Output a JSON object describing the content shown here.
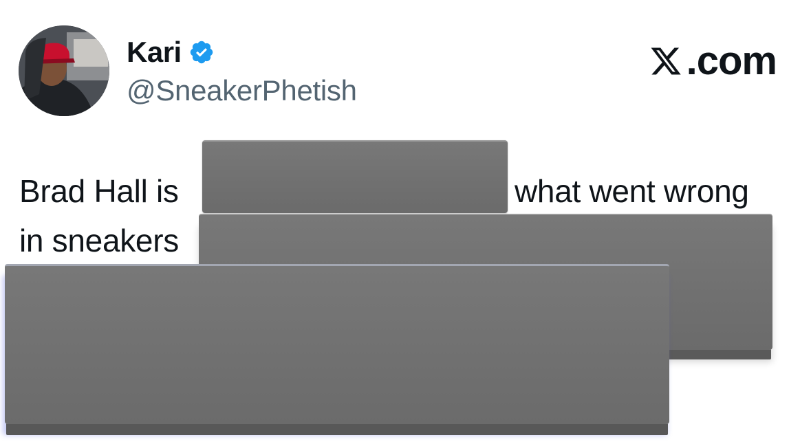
{
  "tweet": {
    "author_name": "Kari",
    "author_handle": "@SneakerPhetish",
    "verified_icon": "verified-badge-icon",
    "body_line1_start": "Brad Hall is",
    "body_line1_end": "what went wrong",
    "body_line2": "in sneakers"
  },
  "brand": {
    "label": ".com",
    "icon": "x-logo-icon"
  },
  "colors": {
    "verified": "#1d9bf0",
    "handle": "#536471",
    "redaction": "#737373"
  }
}
